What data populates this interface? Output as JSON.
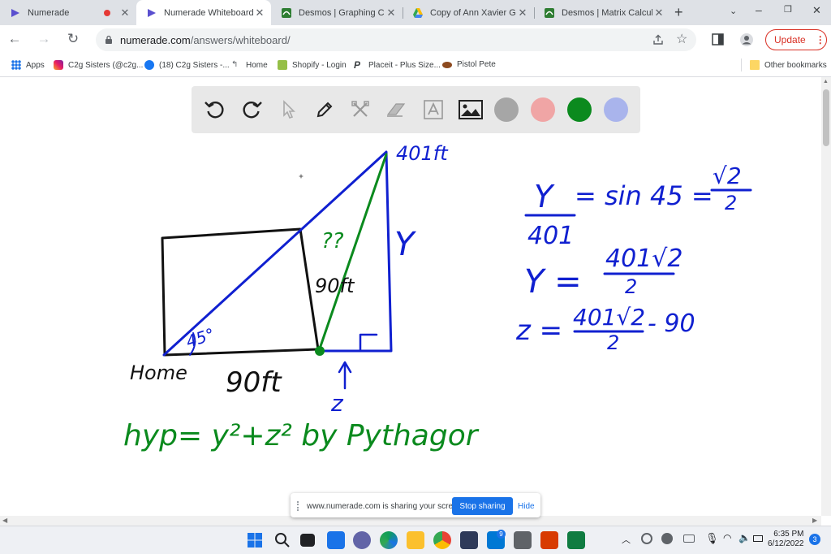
{
  "browser": {
    "tabs": [
      {
        "title": "Numerade",
        "active": false
      },
      {
        "title": "Numerade Whiteboard",
        "active": true
      },
      {
        "title": "Desmos | Graphing Calcul",
        "active": false
      },
      {
        "title": "Copy of Ann Xavier Gante",
        "active": false
      },
      {
        "title": "Desmos | Matrix Calculator",
        "active": false
      }
    ],
    "new_tab_icon": "plus-icon",
    "url_host": "numerade.com",
    "url_path": "/answers/whiteboard/",
    "update_label": "Update"
  },
  "bookmarks": {
    "items": [
      "Apps",
      "C2g Sisters (@c2g...",
      "(18) C2g Sisters -...",
      "Home",
      "Shopify - Login",
      "Placeit - Plus Size...",
      "Pistol Pete"
    ],
    "other": "Other bookmarks"
  },
  "whiteboard": {
    "tools": [
      "undo-icon",
      "redo-icon",
      "pointer-icon",
      "pen-icon",
      "tools-icon",
      "eraser-icon",
      "text-icon",
      "image-icon"
    ],
    "colors": [
      "#a6a6a6",
      "#f0a5a5",
      "#0b8a1e",
      "#a9b4ec"
    ],
    "annotations": {
      "top_vertex": "401ft",
      "y_side": "Y",
      "inner_question": "??",
      "vertical": "90ft",
      "angle": "45°",
      "home": "Home",
      "base": "90ft",
      "z_label": "z",
      "hyp_eq": "hyp= y²+z² by Pythagor",
      "eq1_lhs_num": "Y",
      "eq1_lhs_den": "401",
      "eq1_rhs": "= sin 45 =",
      "eq1_frac_num": "√2",
      "eq1_frac_den": "2",
      "eq2_lhs": "Y =",
      "eq2_num": "401√2",
      "eq2_den": "2",
      "eq3_lhs": "z =",
      "eq3_num": "401√2",
      "eq3_den": "2",
      "eq3_tail": "- 90"
    }
  },
  "share_bar": {
    "text": "www.numerade.com is sharing your screen.",
    "stop": "Stop sharing",
    "hide": "Hide"
  },
  "taskbar": {
    "time": "6:35 PM",
    "date": "6/12/2022",
    "notifications": "3",
    "mail_badge": "9"
  }
}
